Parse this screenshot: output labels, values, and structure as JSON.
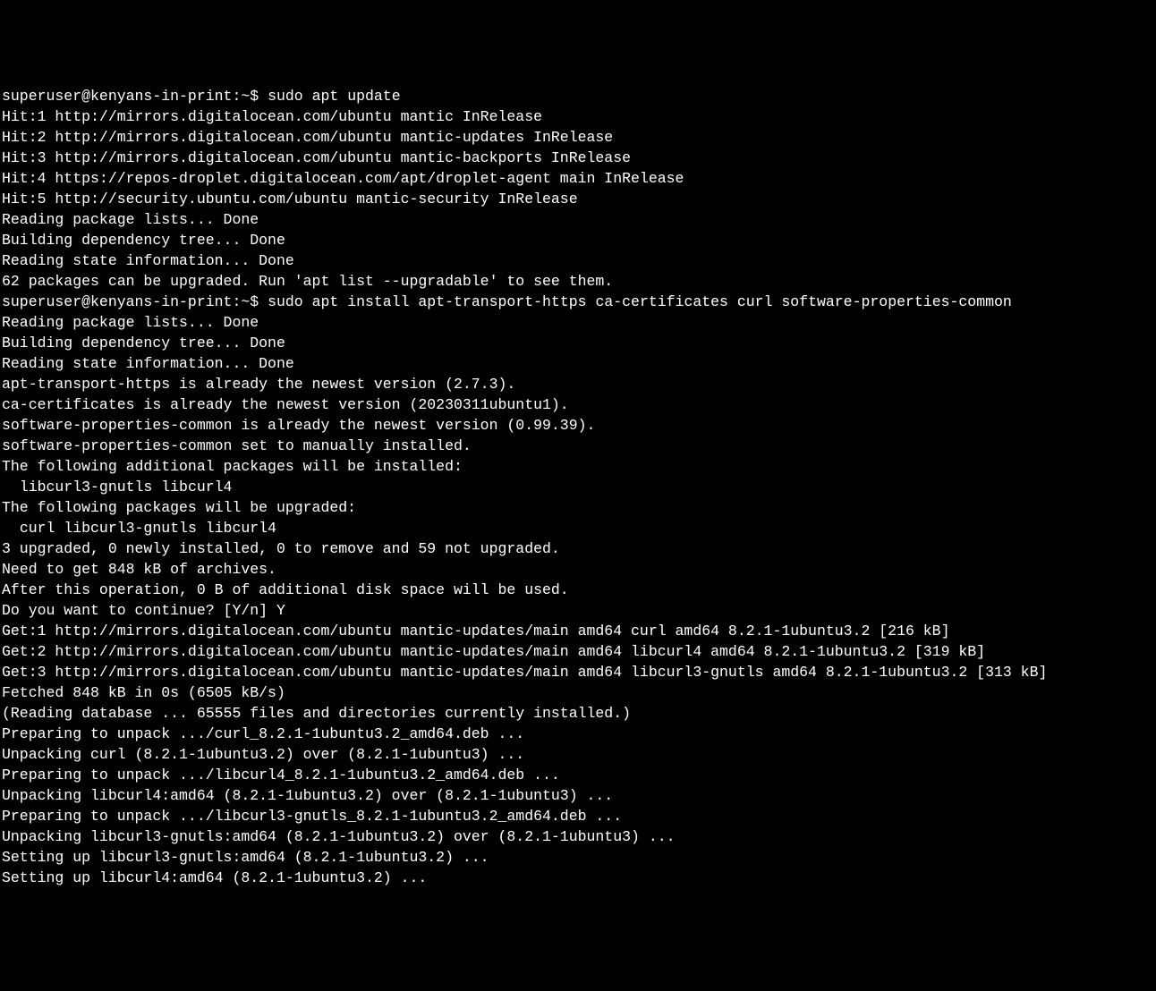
{
  "prompt1": {
    "user_host": "superuser@kenyans-in-print",
    "sep": ":",
    "path": "~",
    "dollar": "$ ",
    "command": "sudo apt update"
  },
  "lines1": [
    "Hit:1 http://mirrors.digitalocean.com/ubuntu mantic InRelease",
    "Hit:2 http://mirrors.digitalocean.com/ubuntu mantic-updates InRelease",
    "Hit:3 http://mirrors.digitalocean.com/ubuntu mantic-backports InRelease",
    "Hit:4 https://repos-droplet.digitalocean.com/apt/droplet-agent main InRelease",
    "Hit:5 http://security.ubuntu.com/ubuntu mantic-security InRelease",
    "Reading package lists... Done",
    "Building dependency tree... Done",
    "Reading state information... Done",
    "62 packages can be upgraded. Run 'apt list --upgradable' to see them."
  ],
  "prompt2": {
    "user_host": "superuser@kenyans-in-print",
    "sep": ":",
    "path": "~",
    "dollar": "$ ",
    "command": "sudo apt install apt-transport-https ca-certificates curl software-properties-common"
  },
  "lines2": [
    "Reading package lists... Done",
    "Building dependency tree... Done",
    "Reading state information... Done",
    "apt-transport-https is already the newest version (2.7.3).",
    "ca-certificates is already the newest version (20230311ubuntu1).",
    "software-properties-common is already the newest version (0.99.39).",
    "software-properties-common set to manually installed.",
    "The following additional packages will be installed:",
    "  libcurl3-gnutls libcurl4",
    "The following packages will be upgraded:",
    "  curl libcurl3-gnutls libcurl4",
    "3 upgraded, 0 newly installed, 0 to remove and 59 not upgraded.",
    "Need to get 848 kB of archives.",
    "After this operation, 0 B of additional disk space will be used.",
    "Do you want to continue? [Y/n] Y",
    "Get:1 http://mirrors.digitalocean.com/ubuntu mantic-updates/main amd64 curl amd64 8.2.1-1ubuntu3.2 [216 kB]",
    "Get:2 http://mirrors.digitalocean.com/ubuntu mantic-updates/main amd64 libcurl4 amd64 8.2.1-1ubuntu3.2 [319 kB]",
    "Get:3 http://mirrors.digitalocean.com/ubuntu mantic-updates/main amd64 libcurl3-gnutls amd64 8.2.1-1ubuntu3.2 [313 kB]",
    "Fetched 848 kB in 0s (6505 kB/s)",
    "(Reading database ... 65555 files and directories currently installed.)",
    "Preparing to unpack .../curl_8.2.1-1ubuntu3.2_amd64.deb ...",
    "Unpacking curl (8.2.1-1ubuntu3.2) over (8.2.1-1ubuntu3) ...",
    "Preparing to unpack .../libcurl4_8.2.1-1ubuntu3.2_amd64.deb ...",
    "Unpacking libcurl4:amd64 (8.2.1-1ubuntu3.2) over (8.2.1-1ubuntu3) ...",
    "Preparing to unpack .../libcurl3-gnutls_8.2.1-1ubuntu3.2_amd64.deb ...",
    "Unpacking libcurl3-gnutls:amd64 (8.2.1-1ubuntu3.2) over (8.2.1-1ubuntu3) ...",
    "Setting up libcurl3-gnutls:amd64 (8.2.1-1ubuntu3.2) ...",
    "Setting up libcurl4:amd64 (8.2.1-1ubuntu3.2) ..."
  ]
}
